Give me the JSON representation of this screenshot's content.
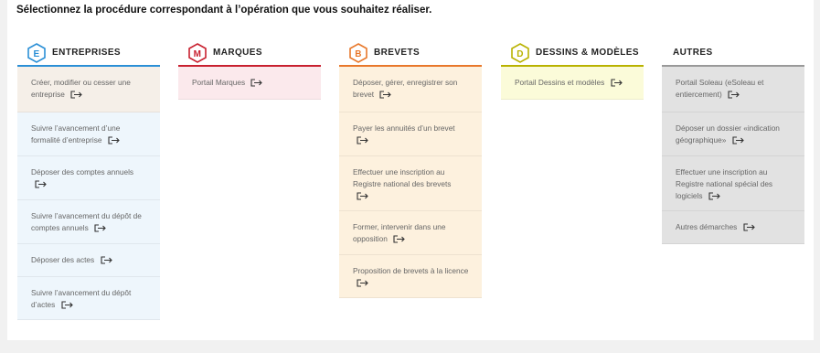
{
  "intro": "Sélectionnez la procédure correspondant à l’opération que vous souhaitez réaliser.",
  "columns": [
    {
      "id": "entreprises",
      "title": "ENTREPRISES",
      "badge": "E",
      "accent": "#2b8fd6",
      "item_bg": "#eef6fc",
      "items": [
        {
          "label": "Créer, modifier ou cesser une entreprise"
        },
        {
          "label": "Suivre l’avancement d’une formalité d’entreprise"
        },
        {
          "label": "Déposer des comptes annuels"
        },
        {
          "label": "Suivre l’avancement du dépôt de comptes annuels"
        },
        {
          "label": "Déposer des actes"
        },
        {
          "label": "Suivre l’avancement du dépôt d’actes"
        }
      ]
    },
    {
      "id": "marques",
      "title": "MARQUES",
      "badge": "M",
      "accent": "#c8202f",
      "item_bg": "#fbe9ec",
      "items": [
        {
          "label": "Portail Marques"
        }
      ]
    },
    {
      "id": "brevets",
      "title": "BREVETS",
      "badge": "B",
      "accent": "#e8782b",
      "item_bg": "#fdf1de",
      "items": [
        {
          "label": "Déposer, gérer, enregistrer son brevet"
        },
        {
          "label": "Payer les annuités d’un brevet"
        },
        {
          "label": "Effectuer une inscription au Registre national des brevets"
        },
        {
          "label": "Former, intervenir dans une opposition"
        },
        {
          "label": "Proposition de brevets à la licence"
        }
      ]
    },
    {
      "id": "dessins",
      "title": "DESSINS & MODÈLES",
      "badge": "D",
      "accent": "#b9b200",
      "item_bg": "#fbfbd9",
      "items": [
        {
          "label": "Portail Dessins et modèles"
        }
      ]
    },
    {
      "id": "autres",
      "title": "AUTRES",
      "badge": "",
      "accent": "#999999",
      "item_bg": "#e2e2e2",
      "items": [
        {
          "label": "Portail Soleau (eSoleau et entiercement)"
        },
        {
          "label": "Déposer un dossier «indication géographique»"
        },
        {
          "label": "Effectuer une inscription au Registre national spécial des logiciels"
        },
        {
          "label": "Autres démarches"
        }
      ]
    }
  ]
}
